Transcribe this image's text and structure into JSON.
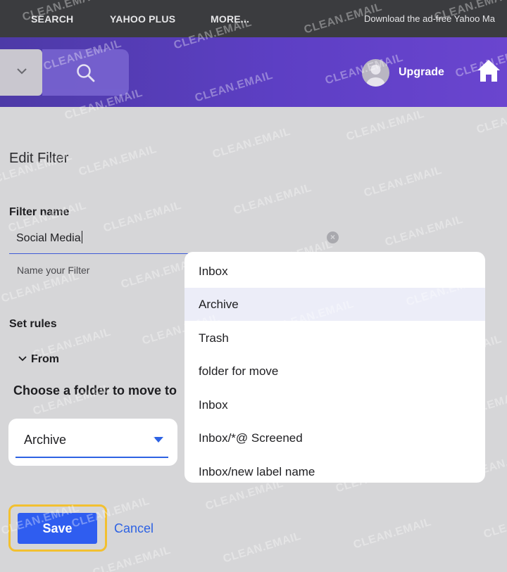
{
  "topbar": {
    "nav": [
      "SEARCH",
      "YAHOO PLUS",
      "MORE..."
    ],
    "promo": "Download the ad-free Yahoo Ma"
  },
  "header": {
    "upgrade_label": "Upgrade"
  },
  "edit_filter": {
    "title": "Edit Filter",
    "filter_name_label": "Filter name",
    "filter_name_value": "Social Media",
    "filter_name_helper": "Name your Filter",
    "set_rules_label": "Set rules",
    "from_label": "From",
    "choose_folder_label": "Choose a folder to move to",
    "folder_selected": "Archive"
  },
  "folder_menu": {
    "options": [
      "Inbox",
      "Archive",
      "Trash",
      "folder for move",
      "Inbox",
      "Inbox/*@ Screened",
      "Inbox/new label name"
    ],
    "selected_index": 1
  },
  "actions": {
    "save_label": "Save",
    "cancel_label": "Cancel"
  },
  "watermark": "CLEAN.EMAIL",
  "colors": {
    "accent": "#2f5df0",
    "header_purple": "#5d3fc4",
    "focus_ring": "#f2c030"
  }
}
